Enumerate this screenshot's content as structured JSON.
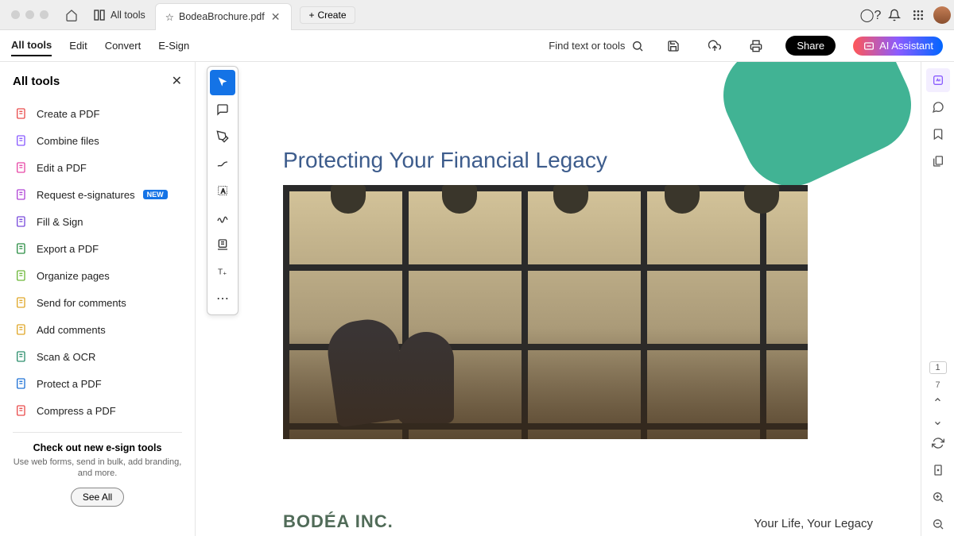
{
  "titlebar": {
    "alltools_tab": "All tools",
    "file_tab": "BodeaBrochure.pdf",
    "create_btn": "Create"
  },
  "menu": {
    "items": [
      "All tools",
      "Edit",
      "Convert",
      "E-Sign"
    ],
    "selected": 0
  },
  "search": {
    "label": "Find text or tools"
  },
  "share_label": "Share",
  "ai_label": "AI Assistant",
  "sidebar": {
    "title": "All tools",
    "items": [
      {
        "label": "Create a PDF",
        "color": "#e94e4e"
      },
      {
        "label": "Combine files",
        "color": "#8a5cff"
      },
      {
        "label": "Edit a PDF",
        "color": "#e749a7"
      },
      {
        "label": "Request e-signatures",
        "color": "#b146d6",
        "badge": "NEW"
      },
      {
        "label": "Fill & Sign",
        "color": "#7a4cdc"
      },
      {
        "label": "Export a PDF",
        "color": "#2d8f46"
      },
      {
        "label": "Organize pages",
        "color": "#6db83a"
      },
      {
        "label": "Send for comments",
        "color": "#e0a82a"
      },
      {
        "label": "Add comments",
        "color": "#e0a82a"
      },
      {
        "label": "Scan & OCR",
        "color": "#2d8f6e"
      },
      {
        "label": "Protect a PDF",
        "color": "#2173d6"
      },
      {
        "label": "Compress a PDF",
        "color": "#e94e4e"
      }
    ],
    "promo_title": "Check out new e-sign tools",
    "promo_text": "Use web forms, send in bulk, add branding, and more.",
    "seeall": "See All"
  },
  "doc": {
    "title": "Protecting Your Financial Legacy",
    "company": "BODÉA INC.",
    "tagline": "Your Life, Your Legacy"
  },
  "pager": {
    "current": "1",
    "total": "7"
  }
}
